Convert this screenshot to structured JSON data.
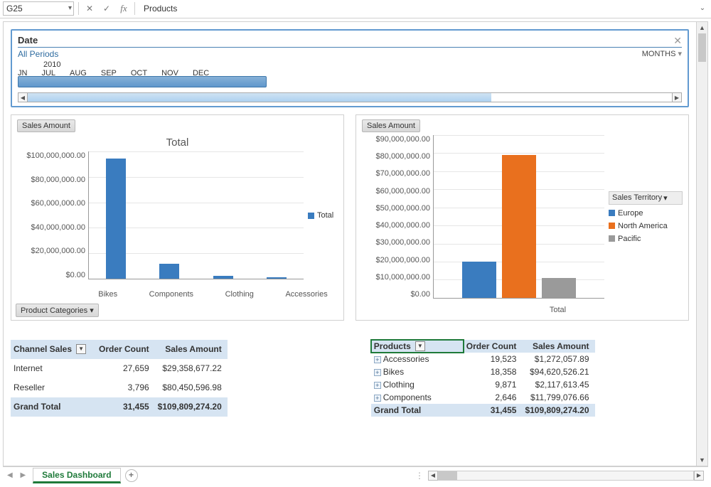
{
  "formula_bar": {
    "cell_ref": "G25",
    "fx_label": "fx",
    "value": "Products"
  },
  "timeline": {
    "title": "Date",
    "selection_label": "All Periods",
    "units_label": "MONTHS",
    "year": "2010",
    "months": [
      "JN",
      "JUL",
      "AUG",
      "SEP",
      "OCT",
      "NOV",
      "DEC"
    ]
  },
  "chart1": {
    "button": "Sales Amount",
    "title": "Total",
    "y_ticks": [
      "$100,000,000.00",
      "$80,000,000.00",
      "$60,000,000.00",
      "$40,000,000.00",
      "$20,000,000.00",
      "$0.00"
    ],
    "categories": [
      "Bikes",
      "Components",
      "Clothing",
      "Accessories"
    ],
    "legend": "Total",
    "bottom_button": "Product Categories"
  },
  "chart2": {
    "button": "Sales Amount",
    "y_ticks": [
      "$90,000,000.00",
      "$80,000,000.00",
      "$70,000,000.00",
      "$60,000,000.00",
      "$50,000,000.00",
      "$40,000,000.00",
      "$30,000,000.00",
      "$20,000,000.00",
      "$10,000,000.00",
      "$0.00"
    ],
    "x_label": "Total",
    "legend_title": "Sales Territory",
    "legend": [
      "Europe",
      "North America",
      "Pacific"
    ]
  },
  "pivot1": {
    "headers": [
      "Channel Sales",
      "Order Count",
      "Sales Amount"
    ],
    "rows": [
      {
        "label": "Internet",
        "count": "27,659",
        "amount": "$29,358,677.22"
      },
      {
        "label": "Reseller",
        "count": "3,796",
        "amount": "$80,450,596.98"
      }
    ],
    "total": {
      "label": "Grand Total",
      "count": "31,455",
      "amount": "$109,809,274.20"
    }
  },
  "pivot2": {
    "headers": [
      "Products",
      "Order Count",
      "Sales Amount"
    ],
    "rows": [
      {
        "label": "Accessories",
        "count": "19,523",
        "amount": "$1,272,057.89"
      },
      {
        "label": "Bikes",
        "count": "18,358",
        "amount": "$94,620,526.21"
      },
      {
        "label": "Clothing",
        "count": "9,871",
        "amount": "$2,117,613.45"
      },
      {
        "label": "Components",
        "count": "2,646",
        "amount": "$11,799,076.66"
      }
    ],
    "total": {
      "label": "Grand Total",
      "count": "31,455",
      "amount": "$109,809,274.20"
    }
  },
  "sheet": {
    "tab": "Sales Dashboard"
  },
  "chart_data": [
    {
      "type": "bar",
      "title": "Total",
      "ylabel": "Sales Amount",
      "ylim": [
        0,
        100000000
      ],
      "categories": [
        "Bikes",
        "Components",
        "Clothing",
        "Accessories"
      ],
      "series": [
        {
          "name": "Total",
          "color": "#3a7cbf",
          "values": [
            94620526.21,
            11799076.66,
            2117613.45,
            1272057.89
          ]
        }
      ]
    },
    {
      "type": "bar",
      "title": "Total",
      "ylabel": "Sales Amount",
      "ylim": [
        0,
        90000000
      ],
      "categories": [
        "Total"
      ],
      "legend_title": "Sales Territory",
      "series": [
        {
          "name": "Europe",
          "color": "#3a7cbf",
          "values": [
            20000000
          ]
        },
        {
          "name": "North America",
          "color": "#e9701e",
          "values": [
            79000000
          ]
        },
        {
          "name": "Pacific",
          "color": "#9a9a9a",
          "values": [
            11000000
          ]
        }
      ]
    }
  ]
}
